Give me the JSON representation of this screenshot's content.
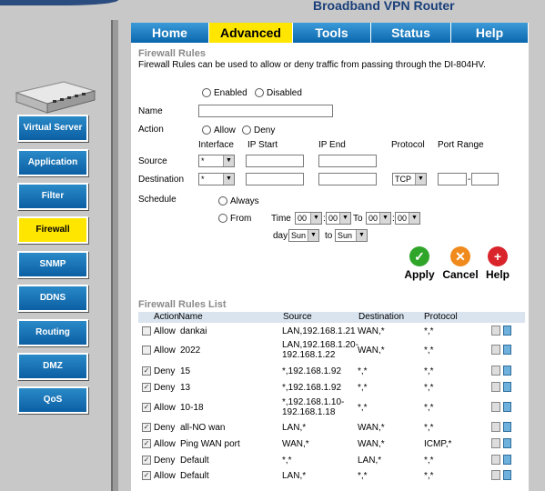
{
  "header": {
    "brand": "Broadband VPN Router"
  },
  "tabs": [
    {
      "label": "Home",
      "active": false
    },
    {
      "label": "Advanced",
      "active": true
    },
    {
      "label": "Tools",
      "active": false
    },
    {
      "label": "Status",
      "active": false
    },
    {
      "label": "Help",
      "active": false
    }
  ],
  "sidebar": {
    "items": [
      {
        "label": "Virtual Server",
        "active": false
      },
      {
        "label": "Application",
        "active": false
      },
      {
        "label": "Filter",
        "active": false
      },
      {
        "label": "Firewall",
        "active": true
      },
      {
        "label": "SNMP",
        "active": false
      },
      {
        "label": "DDNS",
        "active": false
      },
      {
        "label": "Routing",
        "active": false
      },
      {
        "label": "DMZ",
        "active": false
      },
      {
        "label": "QoS",
        "active": false
      }
    ]
  },
  "form": {
    "section_title": "Firewall Rules",
    "description": "Firewall Rules can be used to allow or deny traffic from passing through the DI-804HV.",
    "enabled_label": "Enabled",
    "disabled_label": "Disabled",
    "name_label": "Name",
    "name_value": "",
    "action_label": "Action",
    "allow_label": "Allow",
    "deny_label": "Deny",
    "interface_label": "Interface",
    "ip_start_label": "IP Start",
    "ip_end_label": "IP End",
    "protocol_label": "Protocol",
    "port_range_label": "Port Range",
    "source_label": "Source",
    "destination_label": "Destination",
    "source_interface": "*",
    "destination_interface": "*",
    "protocol_value": "TCP",
    "schedule_label": "Schedule",
    "always_label": "Always",
    "from_label": "From",
    "time_label": "Time",
    "to_label": "To",
    "day_label": "day",
    "to_lower_label": "to",
    "time_from_hour": "00",
    "time_from_min": "00",
    "time_to_hour": "00",
    "time_to_min": "00",
    "day_from": "Sun",
    "day_to": "Sun",
    "colon": ":",
    "dash": "-"
  },
  "buttons": {
    "apply": "Apply",
    "cancel": "Cancel",
    "help": "Help"
  },
  "list": {
    "title": "Firewall Rules List",
    "columns": {
      "action": "Action",
      "name": "Name",
      "source": "Source",
      "destination": "Destination",
      "protocol": "Protocol"
    },
    "rows": [
      {
        "checked": false,
        "action": "Allow",
        "name": "dankai",
        "source": "LAN,192.168.1.21",
        "destination": "WAN,*",
        "protocol": "*,*"
      },
      {
        "checked": false,
        "action": "Allow",
        "name": "2022",
        "source": "LAN,192.168.1.20-192.168.1.22",
        "destination": "WAN,*",
        "protocol": "*,*"
      },
      {
        "checked": true,
        "action": "Deny",
        "name": "15",
        "source": "*,192.168.1.92",
        "destination": "*,*",
        "protocol": "*,*"
      },
      {
        "checked": true,
        "action": "Deny",
        "name": "13",
        "source": "*,192.168.1.92",
        "destination": "*,*",
        "protocol": "*,*"
      },
      {
        "checked": true,
        "action": "Allow",
        "name": "10-18",
        "source": "*,192.168.1.10-192.168.1.18",
        "destination": "*,*",
        "protocol": "*,*"
      },
      {
        "checked": true,
        "action": "Deny",
        "name": "all-NO wan",
        "source": "LAN,*",
        "destination": "WAN,*",
        "protocol": "*,*"
      },
      {
        "checked": true,
        "action": "Allow",
        "name": "Ping WAN port",
        "source": "WAN,*",
        "destination": "WAN,*",
        "protocol": "ICMP,*"
      },
      {
        "checked": true,
        "action": "Deny",
        "name": "Default",
        "source": "*,*",
        "destination": "LAN,*",
        "protocol": "*,*"
      },
      {
        "checked": true,
        "action": "Allow",
        "name": "Default",
        "source": "LAN,*",
        "destination": "*,*",
        "protocol": "*,*"
      }
    ]
  },
  "icons": {
    "apply": "check-icon",
    "cancel": "cancel-icon",
    "help": "plus-help-icon",
    "edit": "edit-icon",
    "delete": "trash-icon"
  },
  "colors": {
    "tab_blue": "#0a67ad",
    "active_yellow": "#ffe600",
    "brand_blue": "#1a3f7a",
    "apply_green": "#2fa52a",
    "cancel_orange": "#f08a1c",
    "help_red": "#d9242b"
  }
}
